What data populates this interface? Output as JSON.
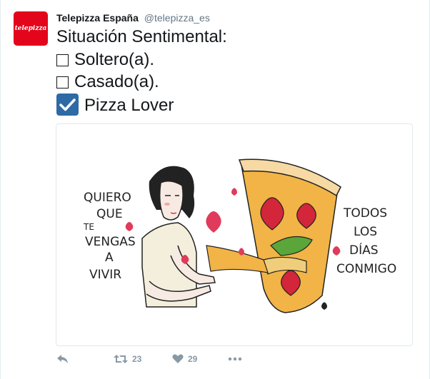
{
  "tweet": {
    "author": {
      "display_name": "Telepizza España",
      "handle": "@telepizza_es",
      "avatar_logo_text": "telepizza"
    },
    "text": {
      "line1": "Situación Sentimental:",
      "line2": "Soltero(a).",
      "line3": "Casado(a).",
      "line4": "Pizza Lover"
    },
    "media": {
      "left_script": [
        "QUIERO",
        "QUE",
        "TE",
        "VENGAS",
        "A",
        "VIVIR"
      ],
      "right_script": [
        "TODOS",
        "LOS",
        "DÍAS",
        "CONMIGO"
      ]
    },
    "actions": {
      "reply_icon": "reply-icon",
      "retweet_icon": "retweet-icon",
      "retweet_count": "23",
      "like_icon": "heart-icon",
      "like_count": "29",
      "more_icon": "more-icon"
    },
    "colors": {
      "brand_red": "#e3051b",
      "check_blue": "#2e6aa6",
      "muted": "#8899a6"
    }
  }
}
